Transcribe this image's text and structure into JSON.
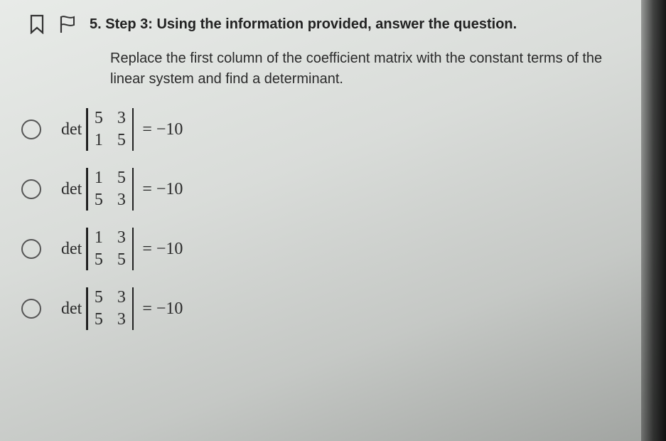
{
  "question": {
    "number": "5.",
    "title": "Step 3: Using the information provided, answer the question.",
    "instruction": "Replace the first column of the coefficient matrix with the constant terms of the linear system and find a determinant."
  },
  "det_label": "det",
  "options": [
    {
      "a": "5",
      "b": "3",
      "c": "1",
      "d": "5",
      "result": "= −10"
    },
    {
      "a": "1",
      "b": "5",
      "c": "5",
      "d": "3",
      "result": "= −10"
    },
    {
      "a": "1",
      "b": "3",
      "c": "5",
      "d": "5",
      "result": "= −10"
    },
    {
      "a": "5",
      "b": "3",
      "c": "5",
      "d": "3",
      "result": "= −10"
    }
  ]
}
